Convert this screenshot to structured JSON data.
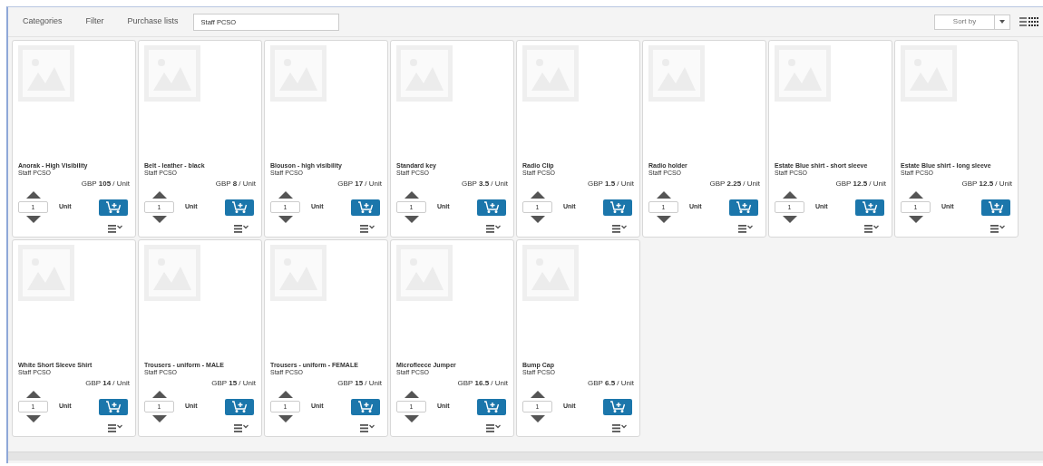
{
  "toolbar": {
    "links": [
      "Categories",
      "Filter",
      "Purchase lists"
    ],
    "search": {
      "value": "Staff PCSO"
    },
    "sort": {
      "placeholder": "Sort by"
    }
  },
  "products": [
    {
      "name": "Anorak - High Visibility",
      "list": "Staff PCSO",
      "price": "GBP **105** / Unit",
      "quantity": "1",
      "unit": "Unit"
    },
    {
      "name": "Belt - leather - black",
      "list": "Staff PCSO",
      "price": "GBP **8** / Unit",
      "quantity": "1",
      "unit": "Unit"
    },
    {
      "name": "Blouson - high visibility",
      "list": "Staff PCSO",
      "price": "GBP **17** / Unit",
      "quantity": "1",
      "unit": "Unit"
    },
    {
      "name": "Standard key",
      "list": "Staff PCSO",
      "price": "GBP **3.5** / Unit",
      "quantity": "1",
      "unit": "Unit"
    },
    {
      "name": "Radio Clip",
      "list": "Staff PCSO",
      "price": "GBP **1.5** / Unit",
      "quantity": "1",
      "unit": "Unit"
    },
    {
      "name": "Radio holder",
      "list": "Staff PCSO",
      "price": "GBP **2.25** / Unit",
      "quantity": "1",
      "unit": "Unit"
    },
    {
      "name": "Estate Blue shirt - short sleeve",
      "list": "Staff PCSO",
      "price": "GBP **12.5** / Unit",
      "quantity": "1",
      "unit": "Unit"
    },
    {
      "name": "Estate Blue shirt - long sleeve",
      "list": "Staff PCSO",
      "price": "GBP **12.5** / Unit",
      "quantity": "1",
      "unit": "Unit"
    },
    {
      "name": "White Short Sleeve Shirt",
      "list": "Staff PCSO",
      "price": "GBP **14** / Unit",
      "quantity": "1",
      "unit": "Unit"
    },
    {
      "name": "Trousers - uniform - MALE",
      "list": "Staff PCSO",
      "price": "GBP **15** / Unit",
      "quantity": "1",
      "unit": "Unit"
    },
    {
      "name": "Trousers - uniform - FEMALE",
      "list": "Staff PCSO",
      "price": "GBP **15** / Unit",
      "quantity": "1",
      "unit": "Unit"
    },
    {
      "name": "Microfleece Jumper",
      "list": "Staff PCSO",
      "price": "GBP **16.5** / Unit",
      "quantity": "1",
      "unit": "Unit"
    },
    {
      "name": "Bump Cap",
      "list": "Staff PCSO",
      "price": "GBP **6.5** / Unit",
      "quantity": "1",
      "unit": "Unit"
    }
  ]
}
